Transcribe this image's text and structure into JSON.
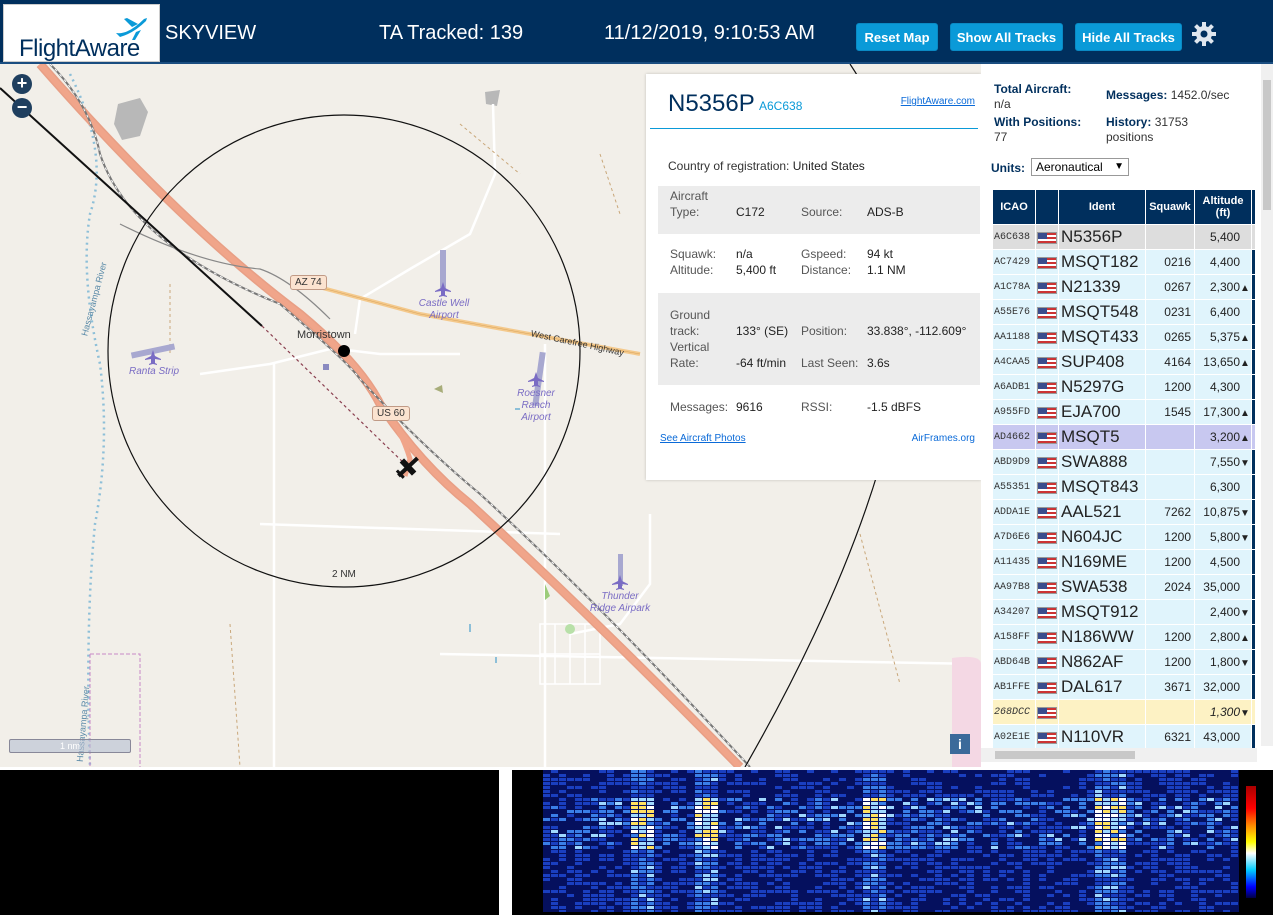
{
  "header": {
    "logo_text": "FlightAware",
    "app_name": "SKYVIEW",
    "tracked": "TA Tracked: 139",
    "datetime": "11/12/2019, 9:10:53 AM",
    "buttons": {
      "reset": "Reset Map",
      "show": "Show All Tracks",
      "hide": "Hide All Tracks"
    },
    "accent_color": "#002f5d",
    "button_color": "#0a9ad8"
  },
  "map": {
    "zoom_in": "+",
    "zoom_out": "−",
    "scale_label": "1 nm",
    "range_ring_label": "2 NM",
    "place_labels": {
      "morristown": "Morristown",
      "az74": "AZ 74",
      "us60": "US 60",
      "highway": "West Carefree Highway",
      "river_upper": "Hassayampa River",
      "river_lower": "Hassayampa River"
    },
    "airports": {
      "castle_well": "Castle Well Airport",
      "ranta": "Ranta Strip",
      "roesner": "Roesner Ranch Airport",
      "thunder": "Thunder Ridge Airpark"
    },
    "info_button": "i"
  },
  "popup": {
    "callsign": "N5356P",
    "icao": "A6C638",
    "link": "FlightAware.com",
    "country_label": "Country of registration:",
    "country_value": "United States",
    "aircraft_label": "Aircraft",
    "type_label": "Type:",
    "type_value": "C172",
    "source_label": "Source:",
    "source_value": "ADS-B",
    "squawk_label": "Squawk:",
    "squawk_value": "n/a",
    "altitude_label": "Altitude:",
    "altitude_value": "5,400 ft",
    "gspeed_label": "Gspeed:",
    "gspeed_value": "94 kt",
    "distance_label": "Distance:",
    "distance_value": "1.1 NM",
    "ground_label": "Ground",
    "track_label": "track:",
    "track_value": "133° (SE)",
    "position_label": "Position:",
    "position_value": "33.838°, -112.609°",
    "vertical_label": "Vertical",
    "rate_label": "Rate:",
    "rate_value": "-64 ft/min",
    "lastseen_label": "Last Seen:",
    "lastseen_value": "3.6s",
    "messages_label": "Messages:",
    "messages_value": "9616",
    "rssi_label": "RSSI:",
    "rssi_value": "-1.5 dBFS",
    "photos_link": "See Aircraft Photos",
    "airframes_link": "AirFrames.org"
  },
  "sidebar": {
    "total_label": "Total Aircraft:",
    "total_value": "n/a",
    "messages_label": "Messages:",
    "messages_value": "1452.0/sec",
    "withpos_label": "With Positions:",
    "withpos_value": "77",
    "history_label": "History:",
    "history_value": "31753",
    "history_unit": "positions",
    "units_label": "Units:",
    "units_value": "Aeronautical",
    "columns": [
      "ICAO",
      "",
      "Ident",
      "Squawk",
      "Altitude (ft)"
    ],
    "rows": [
      {
        "icao": "A6C638",
        "ident": "N5356P",
        "squawk": "",
        "alt": "5,400",
        "arrow": "",
        "state": "selected"
      },
      {
        "icao": "AC7429",
        "ident": "MSQT182",
        "squawk": "0216",
        "alt": "4,400",
        "arrow": "",
        "state": ""
      },
      {
        "icao": "A1C78A",
        "ident": "N21339",
        "squawk": "0267",
        "alt": "2,300",
        "arrow": "▲",
        "state": ""
      },
      {
        "icao": "A55E76",
        "ident": "MSQT548",
        "squawk": "0231",
        "alt": "6,400",
        "arrow": "",
        "state": ""
      },
      {
        "icao": "AA1188",
        "ident": "MSQT433",
        "squawk": "0265",
        "alt": "5,375",
        "arrow": "▲",
        "state": ""
      },
      {
        "icao": "A4CAA5",
        "ident": "SUP408",
        "squawk": "4164",
        "alt": "13,650",
        "arrow": "▲",
        "state": ""
      },
      {
        "icao": "A6ADB1",
        "ident": "N5297G",
        "squawk": "1200",
        "alt": "4,300",
        "arrow": "",
        "state": ""
      },
      {
        "icao": "A955FD",
        "ident": "EJA700",
        "squawk": "1545",
        "alt": "17,300",
        "arrow": "▲",
        "state": ""
      },
      {
        "icao": "AD4662",
        "ident": "MSQT5",
        "squawk": "",
        "alt": "3,200",
        "arrow": "▲",
        "state": "hilite"
      },
      {
        "icao": "ABD9D9",
        "ident": "SWA888",
        "squawk": "",
        "alt": "7,550",
        "arrow": "▼",
        "state": ""
      },
      {
        "icao": "A55351",
        "ident": "MSQT843",
        "squawk": "",
        "alt": "6,300",
        "arrow": "",
        "state": ""
      },
      {
        "icao": "ADDA1E",
        "ident": "AAL521",
        "squawk": "7262",
        "alt": "10,875",
        "arrow": "▼",
        "state": ""
      },
      {
        "icao": "A7D6E6",
        "ident": "N604JC",
        "squawk": "1200",
        "alt": "5,800",
        "arrow": "▼",
        "state": ""
      },
      {
        "icao": "A11435",
        "ident": "N169ME",
        "squawk": "1200",
        "alt": "4,500",
        "arrow": "",
        "state": ""
      },
      {
        "icao": "AA97B8",
        "ident": "SWA538",
        "squawk": "2024",
        "alt": "35,000",
        "arrow": "",
        "state": ""
      },
      {
        "icao": "A34207",
        "ident": "MSQT912",
        "squawk": "",
        "alt": "2,400",
        "arrow": "▼",
        "state": ""
      },
      {
        "icao": "A158FF",
        "ident": "N186WW",
        "squawk": "1200",
        "alt": "2,800",
        "arrow": "▲",
        "state": ""
      },
      {
        "icao": "ABD64B",
        "ident": "N862AF",
        "squawk": "1200",
        "alt": "1,800",
        "arrow": "▼",
        "state": ""
      },
      {
        "icao": "AB1FFE",
        "ident": "DAL617",
        "squawk": "3671",
        "alt": "32,000",
        "arrow": "",
        "state": ""
      },
      {
        "icao": "268DCC",
        "ident": "",
        "squawk": "",
        "alt": "1,300",
        "arrow": "▼",
        "state": "nopos"
      },
      {
        "icao": "A02E1E",
        "ident": "N110VR",
        "squawk": "6321",
        "alt": "43,000",
        "arrow": "",
        "state": ""
      }
    ]
  }
}
